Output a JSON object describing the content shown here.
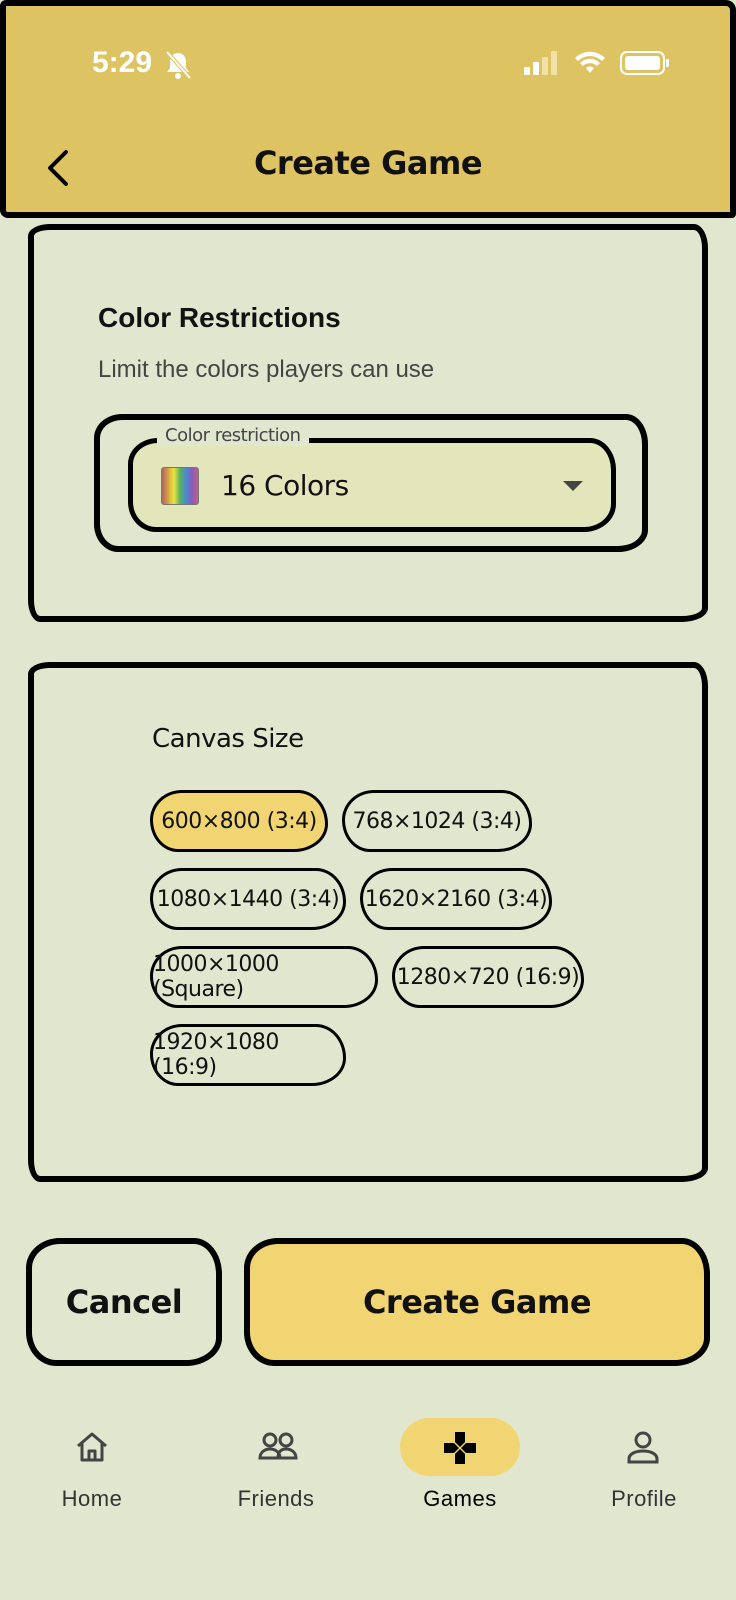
{
  "status_bar": {
    "time": "5:29"
  },
  "header": {
    "title": "Create Game"
  },
  "color_section": {
    "title": "Color Restrictions",
    "subtitle": "Limit the colors players can use",
    "dropdown_label": "Color restriction",
    "selected": "16 Colors"
  },
  "canvas_section": {
    "label": "Canvas Size",
    "options": [
      "600×800 (3:4)",
      "768×1024 (3:4)",
      "1080×1440 (3:4)",
      "1620×2160 (3:4)",
      "1000×1000 (Square)",
      "1280×720 (16:9)",
      "1920×1080 (16:9)"
    ],
    "selected": "600×800 (3:4)"
  },
  "actions": {
    "cancel": "Cancel",
    "create": "Create Game"
  },
  "nav": {
    "items": [
      {
        "label": "Home",
        "icon": "home-icon"
      },
      {
        "label": "Friends",
        "icon": "friends-icon"
      },
      {
        "label": "Games",
        "icon": "gamepad-icon",
        "active": true
      },
      {
        "label": "Profile",
        "icon": "profile-icon"
      }
    ]
  },
  "colors": {
    "header_bg": "#dec362",
    "accent": "#f0d572",
    "page_bg": "#e1e7cf"
  }
}
